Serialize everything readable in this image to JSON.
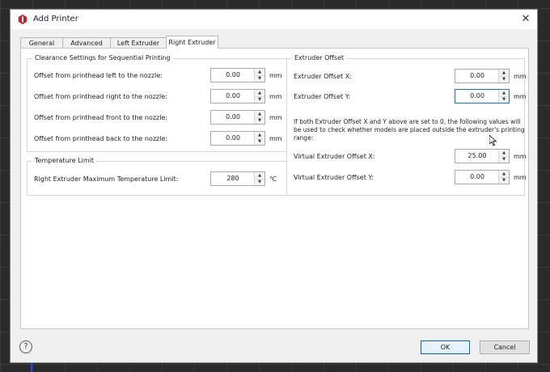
{
  "window": {
    "title": "Add Printer",
    "close_symbol": "✕"
  },
  "tabs": [
    {
      "label": "General",
      "active": false
    },
    {
      "label": "Advanced",
      "active": false
    },
    {
      "label": "Left Extruder",
      "active": false
    },
    {
      "label": "Right Extruder",
      "active": true
    }
  ],
  "clearance": {
    "title": "Clearance Settings for Sequential Printing",
    "rows": [
      {
        "label": "Offset from printhead left to the nozzle:",
        "value": "0.00",
        "unit": "mm"
      },
      {
        "label": "Offset from printhead right to the nozzle:",
        "value": "0.00",
        "unit": "mm"
      },
      {
        "label": "Offset from printhead front to the nozzle:",
        "value": "0.00",
        "unit": "mm"
      },
      {
        "label": "Offset from printhead back to the nozzle:",
        "value": "0.00",
        "unit": "mm"
      }
    ]
  },
  "temperature": {
    "title": "Temperature Limit",
    "label": "Right Extruder Maximum Temperature Limit:",
    "value": "280",
    "unit": "℃"
  },
  "extruder_offset": {
    "title": "Extruder Offset",
    "x": {
      "label": "Extruder Offset X:",
      "value": "0.00",
      "unit": "mm"
    },
    "y": {
      "label": "Extruder Offset Y:",
      "value": "0.00",
      "unit": "mm"
    },
    "note": "If both Extruder Offset X and Y above are set to 0, the following values will be used to check whether models are placed outside the extruder's printing range:",
    "virtual_x": {
      "label": "Virtual Extruder Offset X:",
      "value": "25.00",
      "unit": "mm"
    },
    "virtual_y": {
      "label": "Virtual Extruder Offset Y:",
      "value": "0.00",
      "unit": "mm"
    }
  },
  "spin_arrows": {
    "up": "▲",
    "down": "▼"
  },
  "footer": {
    "help_symbol": "?",
    "ok_label": "OK",
    "cancel_label": "Cancel"
  },
  "colors": {
    "accent": "#1a6fd0",
    "app_icon": "#c0262d"
  }
}
